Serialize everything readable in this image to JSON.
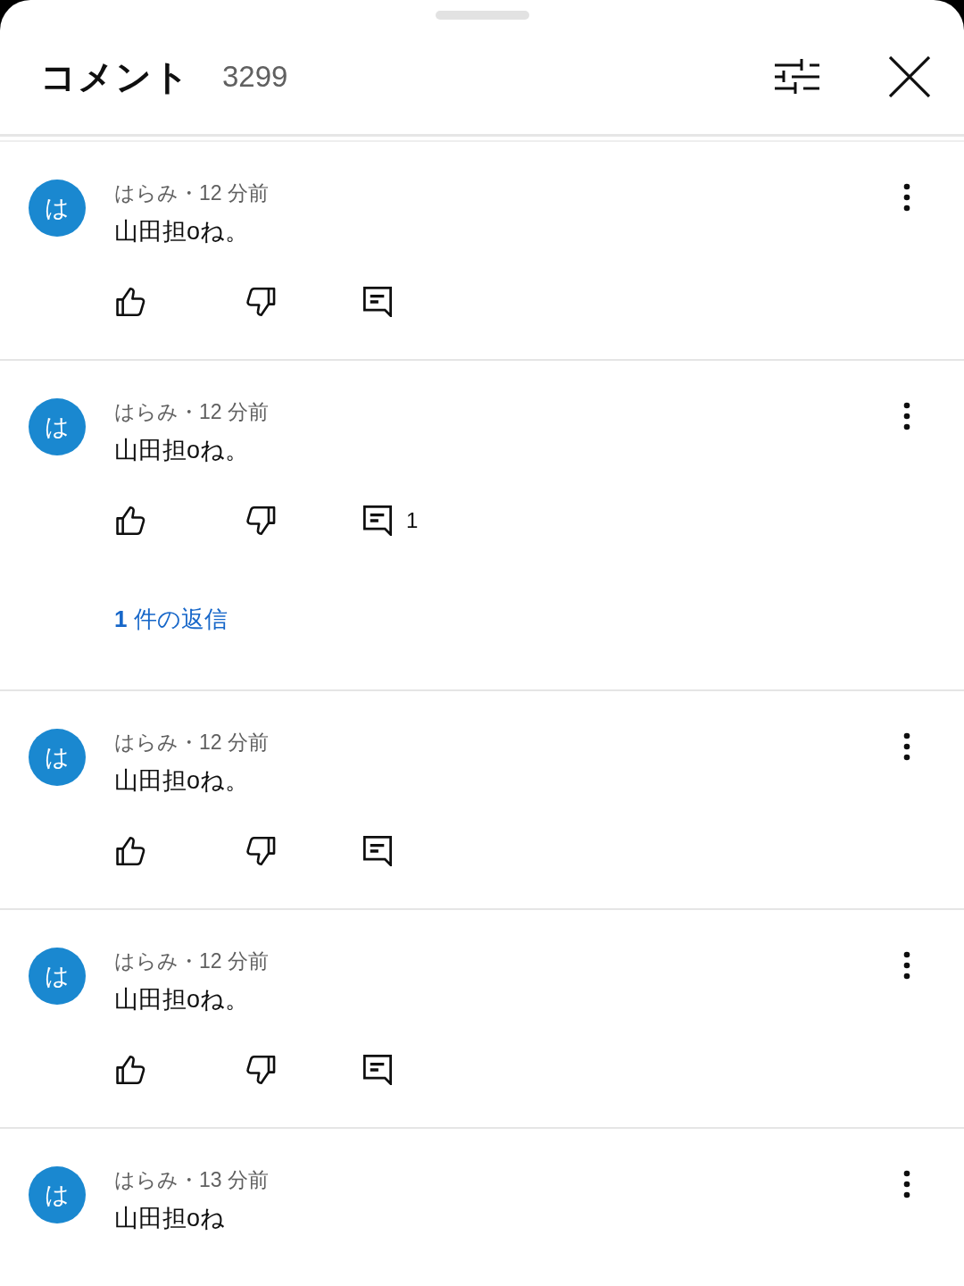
{
  "header": {
    "title": "コメント",
    "count": "3299"
  },
  "comments": [
    {
      "avatar": "は",
      "meta": "はらみ・12 分前",
      "text": "山田担oね。",
      "actions": [
        {
          "kind": "like"
        },
        {
          "kind": "dislike"
        },
        {
          "kind": "reply"
        }
      ]
    },
    {
      "avatar": "は",
      "meta": "はらみ・12 分前",
      "text": "山田担oね。",
      "actions": [
        {
          "kind": "like"
        },
        {
          "kind": "dislike"
        },
        {
          "kind": "reply",
          "count": "1"
        }
      ],
      "replies_link": "**1** 件の返信"
    },
    {
      "avatar": "は",
      "meta": "はらみ・12 分前",
      "text": "山田担oね。",
      "actions": [
        {
          "kind": "like"
        },
        {
          "kind": "dislike"
        },
        {
          "kind": "reply"
        }
      ]
    },
    {
      "avatar": "は",
      "meta": "はらみ・12 分前",
      "text": "山田担oね。",
      "actions": [
        {
          "kind": "like"
        },
        {
          "kind": "dislike"
        },
        {
          "kind": "reply"
        }
      ]
    },
    {
      "avatar": "は",
      "meta": "はらみ・13 分前",
      "text": "山田担oね"
    }
  ]
}
